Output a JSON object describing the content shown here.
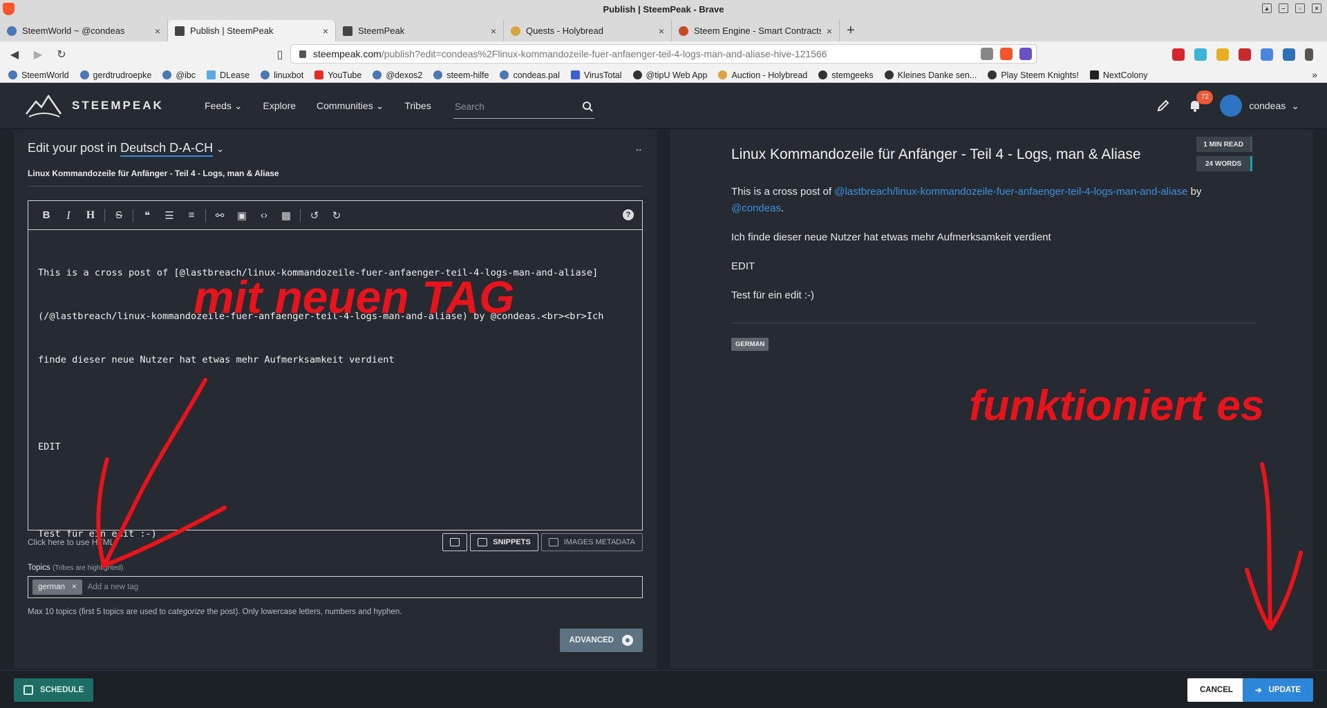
{
  "window": {
    "title": "Publish | SteemPeak - Brave"
  },
  "tabs": [
    {
      "label": "SteemWorld ~ @condeas",
      "icon": "wordpress-icon"
    },
    {
      "label": "Publish | SteemPeak",
      "icon": "steempeak-icon",
      "active": true
    },
    {
      "label": "SteemPeak",
      "icon": "steempeak-icon"
    },
    {
      "label": "Quests - Holybread",
      "icon": "holybread-icon"
    },
    {
      "label": "Steem Engine - Smart Contracts",
      "icon": "steem-engine-icon"
    }
  ],
  "address_bar": {
    "host": "steempeak.com",
    "path": "/publish?edit=condeas%2Flinux-kommandozeile-fuer-anfaenger-teil-4-logs-man-and-aliase-hive-121566"
  },
  "bookmarks": [
    {
      "label": "SteemWorld"
    },
    {
      "label": "gerdtrudroepke"
    },
    {
      "label": "@ibc"
    },
    {
      "label": "DLease"
    },
    {
      "label": "linuxbot"
    },
    {
      "label": "YouTube"
    },
    {
      "label": "@dexos2"
    },
    {
      "label": "steem-hilfe"
    },
    {
      "label": "condeas.pal"
    },
    {
      "label": "VirusTotal"
    },
    {
      "label": "@tipU Web App"
    },
    {
      "label": "Auction - Holybread"
    },
    {
      "label": "stemgeeks"
    },
    {
      "label": "Kleines Danke sen..."
    },
    {
      "label": "Play Steem Knights!"
    },
    {
      "label": "NextColony"
    }
  ],
  "app": {
    "brand": "STEEMPEAK",
    "nav": [
      "Feeds",
      "Explore",
      "Communities",
      "Tribes"
    ],
    "search_placeholder": "Search",
    "notifications_count": "72",
    "username": "condeas"
  },
  "editor": {
    "heading_prefix": "Edit your post in",
    "language": "Deutsch D-A-CH",
    "expand_symbol": "↔",
    "title": "Linux Kommandozeile für Anfänger - Teil 4 - Logs, man & Aliase",
    "body_lines": [
      "This is a cross post of [@lastbreach/linux-kommandozeile-fuer-anfaenger-teil-4-logs-man-and-aliase]",
      "(/@lastbreach/linux-kommandozeile-fuer-anfaenger-teil-4-logs-man-and-aliase) by @condeas.<br><br>Ich",
      "finde dieser neue Nutzer hat etwas mehr Aufmerksamkeit verdient",
      "",
      "EDIT",
      "",
      "Test für ein edit :-)"
    ],
    "html_toggle": "Click here to use HTML",
    "snippets_label": "SNIPPETS",
    "images_metadata_label": "IMAGES METADATA",
    "topics_label": "Topics",
    "topics_sub": "(Tribes are highlighted)",
    "tags": [
      "german"
    ],
    "tag_placeholder": "Add a new tag",
    "topics_hint_a": "Max 10 topics (first 5 topics are used to ",
    "topics_hint_em": "categorize",
    "topics_hint_b": " the post). Only lowercase letters, numbers and hyphen.",
    "advanced_label": "ADVANCED"
  },
  "preview": {
    "read_time": "1 MIN READ",
    "word_count": "24 WORDS",
    "title": "Linux Kommandozeile für Anfänger - Teil 4 - Logs, man & Aliase",
    "p1_text": "This is a cross post of ",
    "p1_link": "@lastbreach/linux-kommandozeile-fuer-anfaenger-teil-4-logs-man-and-aliase",
    "p1_by": " by",
    "p1_user": "@condeas",
    "p1_end": ".",
    "p2": "Ich finde dieser neue Nutzer hat etwas mehr Aufmerksamkeit verdient",
    "p3": "EDIT",
    "p4": "Test für ein edit :-)",
    "tag": "GERMAN"
  },
  "annotations": {
    "left": "mit neuen TAG",
    "right": "funktioniert es",
    "color": "#e8131b"
  },
  "bottom": {
    "schedule_label": "SCHEDULE",
    "cancel_label": "CANCEL",
    "update_label": "UPDATE"
  }
}
